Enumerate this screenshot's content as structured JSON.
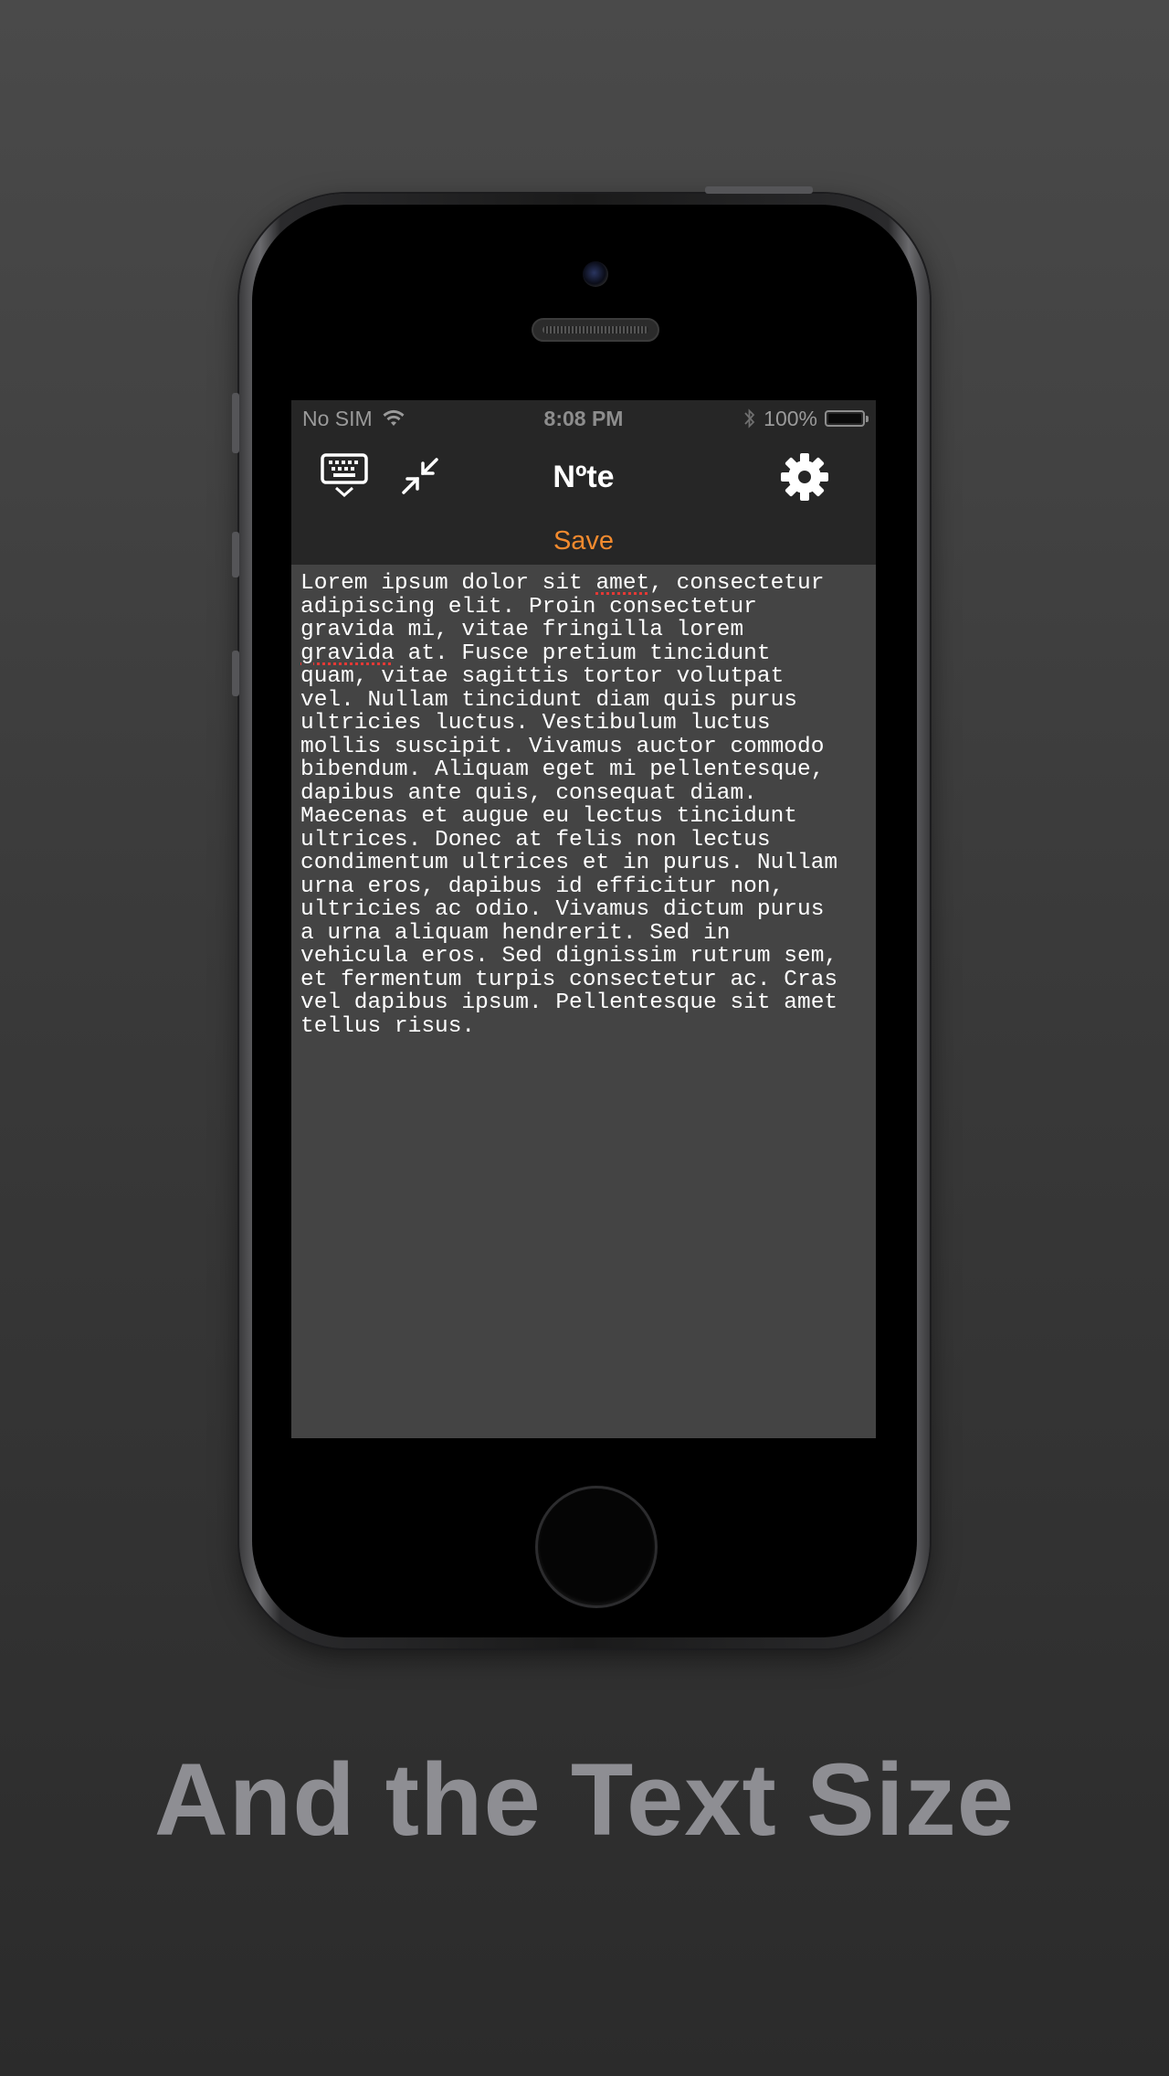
{
  "status_bar": {
    "carrier": "No SIM",
    "time": "8:08 PM",
    "battery_text": "100%"
  },
  "nav": {
    "title": "Nºte",
    "save_label": "Save"
  },
  "icons": {
    "keyboard": "keyboard-dismiss-icon",
    "shrink": "compress-arrows-icon",
    "settings": "gear-icon"
  },
  "note": {
    "line_1a": "Lorem ipsum dolor sit ",
    "word_amet": "amet",
    "line_1b": ", consectetur\nadipiscing elit. Proin consectetur\ngravida mi, vitae fringilla lorem\n",
    "word_gravida": "gravida",
    "body_rest": " at. Fusce pretium tincidunt\nquam, vitae sagittis tortor volutpat\nvel. Nullam tincidunt diam quis purus\nultricies luctus. Vestibulum luctus\nmollis suscipit. Vivamus auctor commodo\nbibendum. Aliquam eget mi pellentesque,\ndapibus ante quis, consequat diam.\nMaecenas et augue eu lectus tincidunt\nultrices. Donec at felis non lectus\ncondimentum ultrices et in purus. Nullam\nurna eros, dapibus id efficitur non,\nultricies ac odio. Vivamus dictum purus\na urna aliquam hendrerit. Sed in\nvehicula eros. Sed dignissim rutrum sem,\net fermentum turpis consectetur ac. Cras\nvel dapibus ipsum. Pellentesque sit amet\ntellus risus."
  },
  "caption": "And the Text Size",
  "colors": {
    "accent": "#f28a2e",
    "bar": "#262626",
    "editor_bg": "#444444",
    "misspell": "#e53935"
  }
}
